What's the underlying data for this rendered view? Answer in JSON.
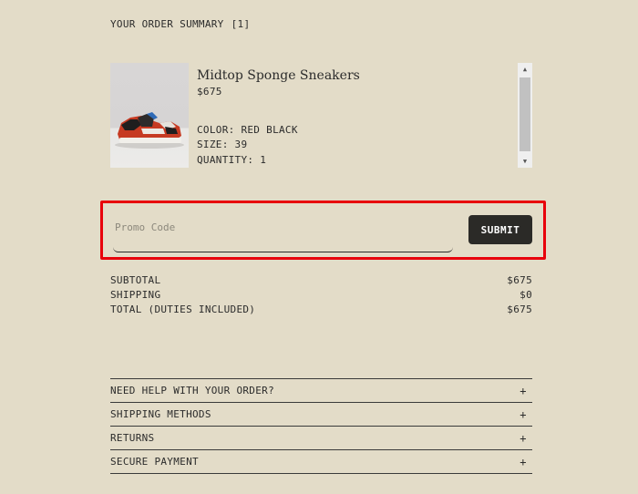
{
  "summary": {
    "title": "YOUR ORDER SUMMARY",
    "count": "[1]"
  },
  "item": {
    "name": "Midtop Sponge Sneakers",
    "price": "$675",
    "color": "COLOR: RED BLACK",
    "size": "SIZE: 39",
    "quantity": "QUANTITY: 1",
    "image_icon": "sneaker-image"
  },
  "promo": {
    "placeholder": "Promo Code",
    "value": "",
    "submit_label": "SUBMIT",
    "highlight_color": "#e8000b"
  },
  "totals": [
    {
      "label": "SUBTOTAL",
      "value": "$675"
    },
    {
      "label": "SHIPPING",
      "value": "$0"
    },
    {
      "label": "TOTAL (DUTIES INCLUDED)",
      "value": "$675"
    }
  ],
  "help": [
    {
      "label": "NEED HELP WITH YOUR ORDER?",
      "icon": "+"
    },
    {
      "label": "SHIPPING METHODS",
      "icon": "+"
    },
    {
      "label": "RETURNS",
      "icon": "+"
    },
    {
      "label": "SECURE PAYMENT",
      "icon": "+"
    }
  ],
  "colors": {
    "background": "#e3dcc8",
    "button": "#2b2a27",
    "text": "#2b2b2b"
  }
}
